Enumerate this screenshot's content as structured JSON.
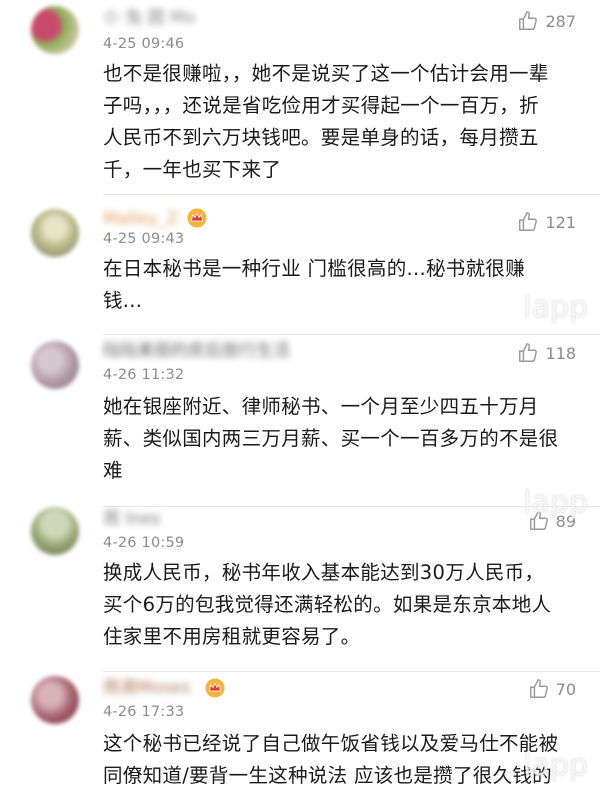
{
  "comments": [
    {
      "username": "小 兔 圆 Mo",
      "has_crown": false,
      "time": "4-25 09:46",
      "likes": "287",
      "lines": [
        "也不是很赚啦，，她不是说买了这一个估计会用一辈",
        "子吗，，，还说是省吃俭用才买得起一个一百万，折",
        "人民币不到六万块钱吧。要是单身的话，每月攒五",
        "千，一年也买下来了"
      ],
      "avatar_colors": [
        "#c84a6b",
        "#8fb35a",
        "#d8c6b0"
      ]
    },
    {
      "username": "Malley_Z",
      "has_crown": true,
      "time": "4-25 09:43",
      "likes": "121",
      "lines": [
        "在日本秘书是一种行业  门槛很高的...秘书就很赚",
        "钱..."
      ],
      "avatar_colors": [
        "#b9b98a",
        "#e8e4c8",
        "#8a9270"
      ]
    },
    {
      "username": "陆陆美丽的房后旅行生活",
      "has_crown": false,
      "time": "4-26 11:32",
      "likes": "118",
      "lines": [
        "她在银座附近、律师秘书、一个月至少四五十万月",
        "薪、类似国内两三万月薪、买一个一百多万的不是很",
        "难"
      ],
      "avatar_colors": [
        "#b09aa6",
        "#d6c8cf",
        "#8a7480"
      ]
    },
    {
      "username": "周 Ines",
      "has_crown": false,
      "time": "4-26 10:59",
      "likes": "89",
      "lines": [
        "换成人民币，秘书年收入基本能达到30万人民币，",
        "买个6万的包我觉得还满轻松的。如果是东京本地人",
        "住家里不用房租就更容易了。"
      ],
      "avatar_colors": [
        "#9aa876",
        "#cfd7b8",
        "#6f7a55"
      ]
    },
    {
      "username": "雨滴Moses",
      "has_crown": true,
      "time": "4-26 17:33",
      "likes": "70",
      "lines": [
        "这个秘书已经说了自己做午饭省钱以及爱马仕不能被",
        "同僚知道/要背一生这种说法 应该也是攒了很久钱的"
      ],
      "avatar_colors": [
        "#a5606d",
        "#d9b3b8",
        "#7a3f4b"
      ]
    }
  ],
  "watermarks": [
    {
      "text": "lapp",
      "top_pct": 37
    },
    {
      "text": "lapp",
      "top_pct": 62
    },
    {
      "text": "lapp",
      "top_pct": 95
    }
  ]
}
